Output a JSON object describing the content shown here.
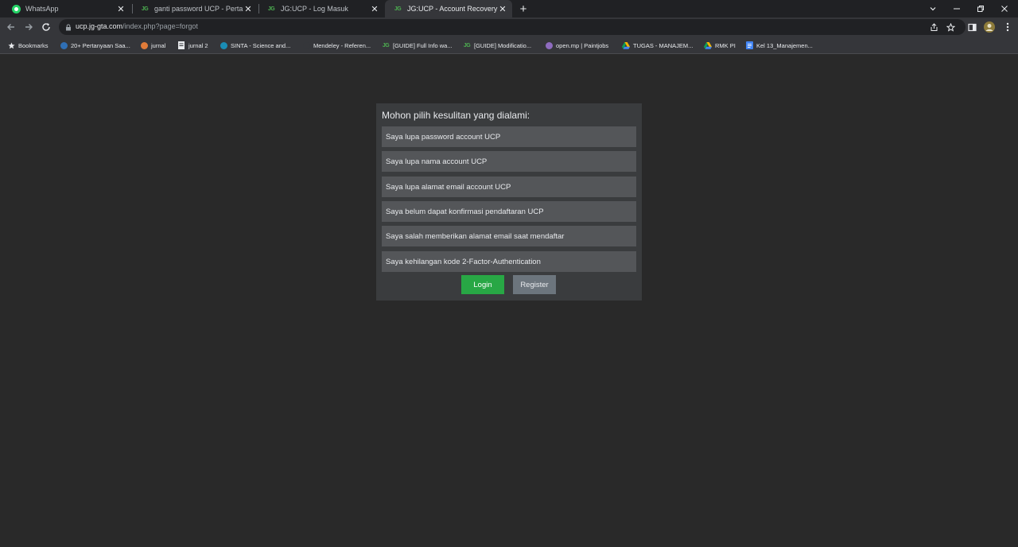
{
  "tabs": [
    {
      "title": "WhatsApp",
      "icon": "whatsapp-icon",
      "active": false
    },
    {
      "title": "ganti password UCP - Pertanyaan",
      "icon": "jg-logo-icon",
      "active": false
    },
    {
      "title": "JG:UCP - Log Masuk",
      "icon": "jg-logo-icon",
      "active": false
    },
    {
      "title": "JG:UCP - Account Recovery",
      "icon": "jg-logo-icon",
      "active": true
    }
  ],
  "address_bar": {
    "host": "ucp.jg-gta.com",
    "path": "/index.php?page=forgot"
  },
  "bookmarks": [
    {
      "label": "Bookmarks",
      "icon": "star-icon"
    },
    {
      "label": "20+ Pertanyaan Saa...",
      "icon": "globe-icon"
    },
    {
      "label": "jurnal",
      "icon": "journal-icon"
    },
    {
      "label": "jurnal 2",
      "icon": "document-icon"
    },
    {
      "label": "SINTA - Science and...",
      "icon": "sinta-icon"
    },
    {
      "label": "Mendeley - Referen...",
      "icon": "mendeley-icon"
    },
    {
      "label": "[GUIDE] Full Info wa...",
      "icon": "jg-logo-icon"
    },
    {
      "label": "[GUIDE] Modificatio...",
      "icon": "jg-logo-icon"
    },
    {
      "label": "open.mp | Paintjobs",
      "icon": "openmp-icon"
    },
    {
      "label": "TUGAS - MANAJEM...",
      "icon": "google-drive-icon"
    },
    {
      "label": "RMK PI",
      "icon": "google-drive-icon"
    },
    {
      "label": "Kel 13_Manajemen...",
      "icon": "google-docs-icon"
    }
  ],
  "recovery": {
    "heading": "Mohon pilih kesulitan yang dialami:",
    "options": [
      "Saya lupa password account UCP",
      "Saya lupa nama account UCP",
      "Saya lupa alamat email account UCP",
      "Saya belum dapat konfirmasi pendaftaran UCP",
      "Saya salah memberikan alamat email saat mendaftar",
      "Saya kehilangan kode 2-Factor-Authentication"
    ],
    "login_label": "Login",
    "register_label": "Register"
  },
  "colors": {
    "page_background": "#292929",
    "card_background": "#3a3c3e",
    "option_background": "#545659",
    "login_button": "#28a745",
    "register_button": "#6c757d"
  }
}
